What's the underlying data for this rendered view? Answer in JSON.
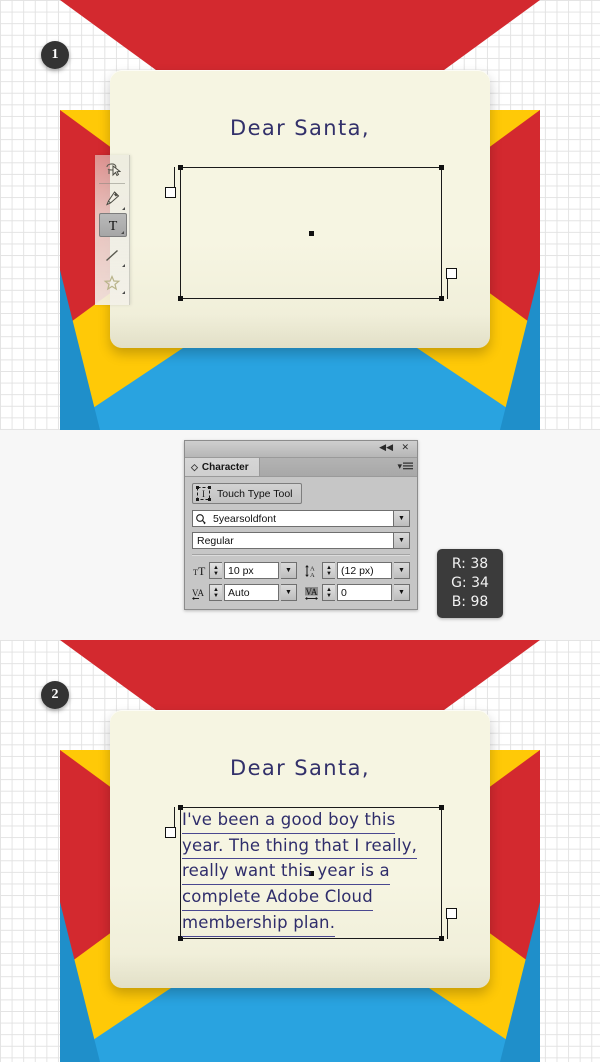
{
  "steps": [
    {
      "number": "1"
    },
    {
      "number": "2"
    }
  ],
  "artwork": {
    "salutation": "Dear Santa,",
    "letter_lines": [
      "I've been a good boy this",
      "year. The thing that I really,",
      "really want this year is a",
      "complete Adobe Cloud",
      "membership plan."
    ],
    "colors": {
      "envelope_red": "#d3292f",
      "envelope_yellow": "#ffc907",
      "envelope_blue": "#29a3e0",
      "paper_cream": "#f6f5e2",
      "ink_navy": "#2f2d6b"
    }
  },
  "toolbar": {
    "tools": [
      {
        "name": "lasso-tool",
        "label": "Lasso Tool",
        "selected": false
      },
      {
        "name": "pen-tool",
        "label": "Pen Tool",
        "selected": false
      },
      {
        "name": "type-tool",
        "label": "Type Tool",
        "selected": true
      },
      {
        "name": "line-segment-tool",
        "label": "Line Segment Tool",
        "selected": false
      },
      {
        "name": "star-tool",
        "label": "Star Tool",
        "selected": false
      }
    ]
  },
  "character_panel": {
    "title": "Character",
    "titlebar": {
      "collapse": "◀◀",
      "close": "✕",
      "menu": "▾"
    },
    "touch_type_tool_label": "Touch Type Tool",
    "font_family": "5yearsoldfont",
    "font_style": "Regular",
    "font_size": "10 px",
    "leading": "(12 px)",
    "kerning": "Auto",
    "tracking": "0",
    "dropdown_arrow": "▼",
    "spinner_up": "▲",
    "spinner_down": "▼"
  },
  "rgb_readout": {
    "r": "R: 38",
    "g": "G: 34",
    "b": "B: 98"
  }
}
